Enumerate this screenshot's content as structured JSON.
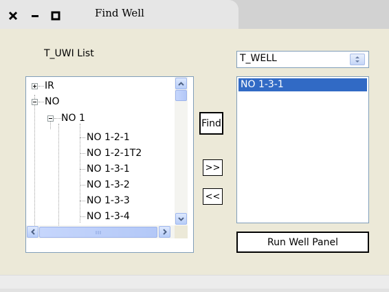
{
  "window": {
    "title": "Find Well",
    "controls": [
      "close-icon",
      "minimize-icon",
      "maximize-icon"
    ]
  },
  "tree_panel": {
    "label": "T_UWI List",
    "nodes": [
      {
        "label": "IR",
        "state": "collapsed",
        "level": 0
      },
      {
        "label": "NO",
        "state": "expanded",
        "level": 0
      },
      {
        "label": "NO 1",
        "state": "expanded",
        "level": 1
      },
      {
        "label": "NO 1-2-1",
        "level": 2
      },
      {
        "label": "NO 1-2-1T2",
        "level": 2
      },
      {
        "label": "NO 1-3-1",
        "level": 2
      },
      {
        "label": "NO 1-3-2",
        "level": 2
      },
      {
        "label": "NO 1-3-3",
        "level": 2
      },
      {
        "label": "NO 1-3-4",
        "level": 2
      }
    ]
  },
  "actions": {
    "find_label": "Find",
    "add_label": ">>",
    "remove_label": "<<"
  },
  "well_type": {
    "selected": "T_WELL"
  },
  "selected_list": {
    "items": [
      "NO 1-3-1"
    ]
  },
  "run_button": {
    "label": "Run Well Panel"
  },
  "colors": {
    "selection": "#316ac5",
    "panel_bg": "#ece9d8",
    "border": "#7f9db9"
  }
}
